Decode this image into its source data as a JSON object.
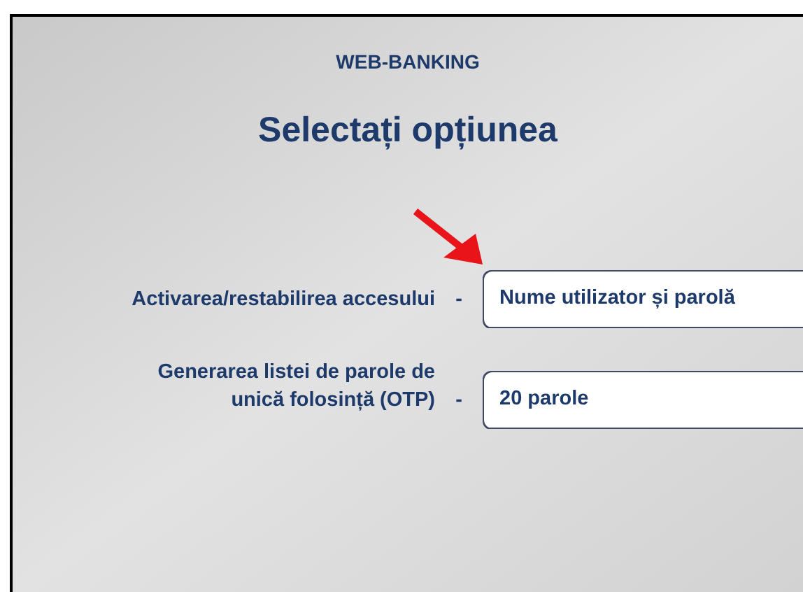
{
  "header": {
    "title": "WEB-BANKING",
    "heading": "Selectați opțiunea"
  },
  "options": [
    {
      "label": "Activarea/restabilirea accesului",
      "separator": "-",
      "button": "Nume utilizator și parolă"
    },
    {
      "label": "Generarea listei de parole de\nunică folosință (OTP)",
      "separator": "-",
      "button": "20 parole"
    }
  ]
}
